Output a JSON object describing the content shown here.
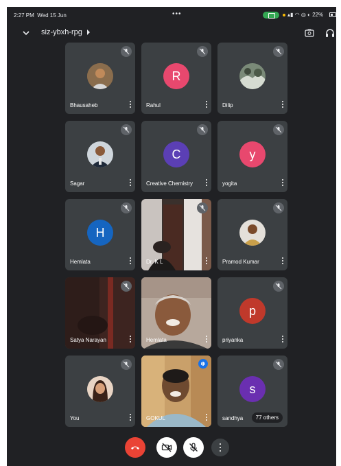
{
  "status_bar": {
    "time": "2:27 PM",
    "date": "Wed 15 Jun",
    "battery": "22%",
    "battery_pill_color": "#34a853"
  },
  "meeting": {
    "code": "siz-ybxh-rpg",
    "icons": [
      "chevron-down-icon",
      "caret-right-icon",
      "flip-camera-icon",
      "headphones-icon"
    ]
  },
  "participants": [
    {
      "name": "Bhausaheb",
      "type": "photo",
      "muted": true
    },
    {
      "name": "Rahul",
      "type": "initial",
      "initial": "R",
      "color": "#e8486e",
      "muted": true
    },
    {
      "name": "Dilip",
      "type": "photo",
      "muted": true
    },
    {
      "name": "Sagar",
      "type": "photo",
      "muted": true
    },
    {
      "name": "Creative Chemistry",
      "type": "initial",
      "initial": "C",
      "color": "#5b3fb5",
      "muted": true
    },
    {
      "name": "yogita",
      "type": "initial",
      "initial": "y",
      "color": "#e8486e",
      "muted": true
    },
    {
      "name": "Hemlata",
      "type": "initial",
      "initial": "H",
      "color": "#1565c0",
      "muted": true
    },
    {
      "name": "Dr. K L",
      "type": "video",
      "muted": true
    },
    {
      "name": "Pramod Kumar",
      "type": "photo",
      "muted": true
    },
    {
      "name": "Satya Narayan",
      "type": "video",
      "muted": true
    },
    {
      "name": "Hemlata",
      "type": "video",
      "muted": false
    },
    {
      "name": "priyanka",
      "type": "initial",
      "initial": "p",
      "color": "#c0392b",
      "muted": true
    },
    {
      "name": "You",
      "type": "photo",
      "muted": true
    },
    {
      "name": "GOKUL",
      "type": "video",
      "muted": false,
      "speaking": true
    },
    {
      "name": "sandhya",
      "type": "initial",
      "initial": "s",
      "color": "#6a2fb0",
      "muted": true,
      "others_label": "77 others"
    }
  ],
  "controls": {
    "end_call_color": "#ea4335",
    "items": [
      "end-call-icon",
      "camera-off-icon",
      "mic-off-icon",
      "more-vert-icon"
    ]
  }
}
